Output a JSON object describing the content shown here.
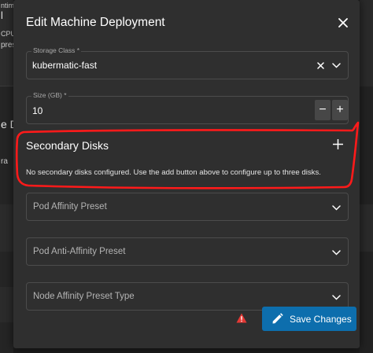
{
  "background": {
    "fragments": [
      "ntime",
      "l",
      "CPU",
      "pres",
      "e D",
      "ra"
    ]
  },
  "dialog": {
    "title": "Edit Machine Deployment",
    "close_icon": "close-icon"
  },
  "storage_class": {
    "label": "Storage Class *",
    "value": "kubermatic-fast",
    "clear_icon": "clear-icon",
    "dropdown_icon": "chevron-down-icon"
  },
  "size": {
    "label": "Size (GB) *",
    "value": "10",
    "decrement_label": "−",
    "increment_label": "+"
  },
  "secondary_disks": {
    "title": "Secondary Disks",
    "add_icon": "plus-icon",
    "empty_message": "No secondary disks configured. Use the add button above to configure up to three disks."
  },
  "pod_affinity": {
    "placeholder": "Pod Affinity Preset"
  },
  "pod_anti_affinity": {
    "placeholder": "Pod Anti-Affinity Preset"
  },
  "node_affinity": {
    "placeholder": "Node Affinity Preset Type"
  },
  "footer": {
    "save_label": "Save Changes",
    "save_icon": "pencil-icon",
    "warning_icon": "warning-icon"
  },
  "colors": {
    "dialog_bg": "#2f2f2f",
    "field_border": "#4c4c4c",
    "primary_button": "#0d6ead",
    "warning": "#e53935",
    "annotation": "#ff1a1a"
  }
}
